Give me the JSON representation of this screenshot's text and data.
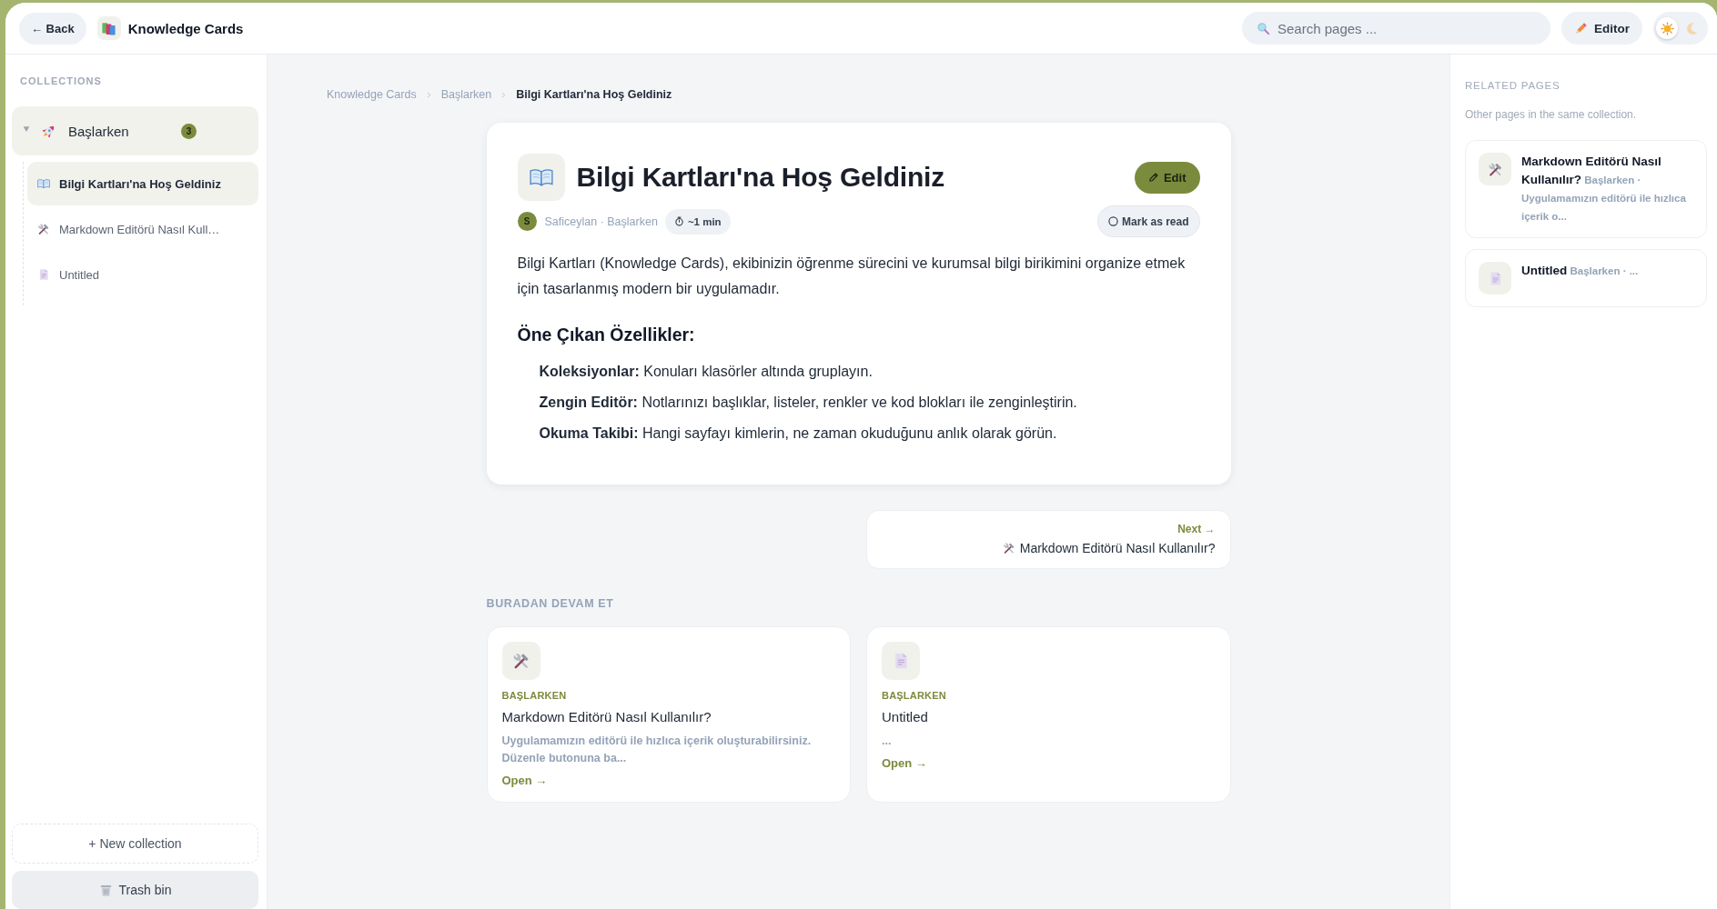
{
  "topbar": {
    "back_button": "← Back",
    "app_title": "Knowledge Cards",
    "search": {
      "placeholder": "Search pages ..."
    },
    "editor_button": "Editor",
    "theme_options": [
      {
        "kind": "light",
        "selected": true
      },
      {
        "kind": "dark",
        "selected": false
      }
    ]
  },
  "sidebar": {
    "heading": "COLLECTIONS",
    "collections": [
      {
        "name": "Başlarken",
        "count": "3",
        "expanded": true,
        "selected": true,
        "pages": [
          {
            "kind": "book",
            "title": "Bilgi Kartları'na Hoş Geldiniz",
            "selected": true
          },
          {
            "kind": "tools",
            "title": "Markdown Editörü Nasıl Kull…",
            "selected": false
          },
          {
            "kind": "doc",
            "title": "Untitled",
            "selected": false
          }
        ]
      }
    ],
    "new_collection_button": "+ New collection",
    "trash_button": "Trash bin"
  },
  "main": {
    "breadcrumb": [
      {
        "label": "Knowledge Cards",
        "current": false
      },
      {
        "label": "Başlarken",
        "current": false
      },
      {
        "label": "Bilgi Kartları'na Hoş Geldiniz",
        "current": true
      }
    ],
    "article": {
      "kind": "book",
      "title": "Bilgi Kartları'na Hoş Geldiniz",
      "edit_button": "Edit",
      "author_initial": "S",
      "meta": "Saficeylan · Başlarken",
      "read_time": "~1 min",
      "mark_read": {
        "label": "Mark as read",
        "read": false
      },
      "intro": "Bilgi Kartları (Knowledge Cards), ekibinizin öğrenme sürecini ve kurumsal bilgi birikimini organize etmek için tasarlanmış modern bir uygulamadır.",
      "heading": "Öne Çıkan Özellikler:",
      "features": [
        "**Koleksiyonlar:** Konuları klasörler altında gruplayın.",
        "**Zengin Editör:** Notlarınızı başlıklar, listeler, renkler ve kod blokları ile zenginleştirin.",
        "**Okuma Takibi:** Hangi sayfayı kimlerin, ne zaman okuduğunu anlık olarak görün."
      ]
    },
    "next": {
      "label": "Next →",
      "kind": "tools",
      "title": "Markdown Editörü Nasıl Kullanılır?"
    },
    "continue": {
      "heading": "BURADAN DEVAM ET",
      "cards": [
        {
          "kind": "tools",
          "collection": "BAŞLARKEN",
          "title": "Markdown Editörü Nasıl Kullanılır?",
          "excerpt": "Uygulamamızın editörü ile hızlıca içerik oluşturabilirsiniz. Düzenle butonuna ba...",
          "link": "Open →"
        },
        {
          "kind": "doc",
          "collection": "BAŞLARKEN",
          "title": "Untitled",
          "excerpt": "...",
          "link": "Open →"
        }
      ]
    }
  },
  "related": {
    "heading": "RELATED PAGES",
    "subtitle": "Other pages in the same collection.",
    "pages": [
      {
        "kind": "tools",
        "title": "Markdown Editörü Nasıl Kullanılır?",
        "meta": "Başlarken · Uygulamamızın editörü ile hızlıca içerik o..."
      },
      {
        "kind": "doc",
        "title": "Untitled",
        "meta": "Başlarken · ..."
      }
    ]
  }
}
